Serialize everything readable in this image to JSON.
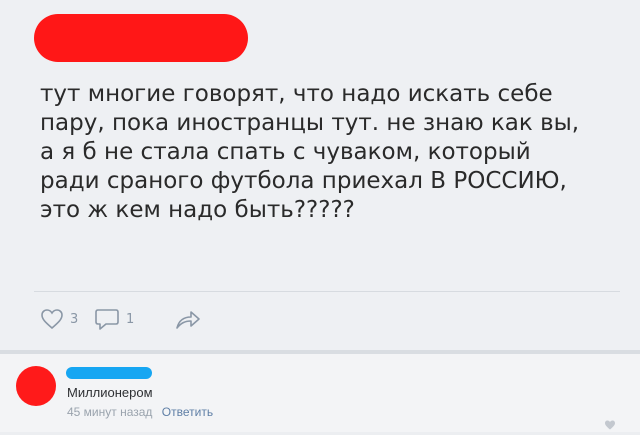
{
  "post": {
    "text": "тут многие говорят, что надо искать себе\nпару, пока иностранцы тут. не знаю как вы,\nа я б не стала спать с чуваком, который\nради сраного футбола приехал В РОССИЮ,\nэто ж кем надо быть?????",
    "likes_count": "3",
    "comments_count": "1"
  },
  "comment": {
    "text": "Миллионером",
    "time": "45 минут назад",
    "reply_label": "Ответить"
  },
  "icons": {
    "like": "heart-icon",
    "comment": "comment-bubble-icon",
    "share": "share-arrow-icon",
    "comment_like": "small-heart-icon"
  },
  "colors": {
    "redaction_red": "#ff1717",
    "redaction_blue": "#16a6f2",
    "icon_gray": "#8a97a6",
    "link_blue": "#5f7fa6"
  }
}
